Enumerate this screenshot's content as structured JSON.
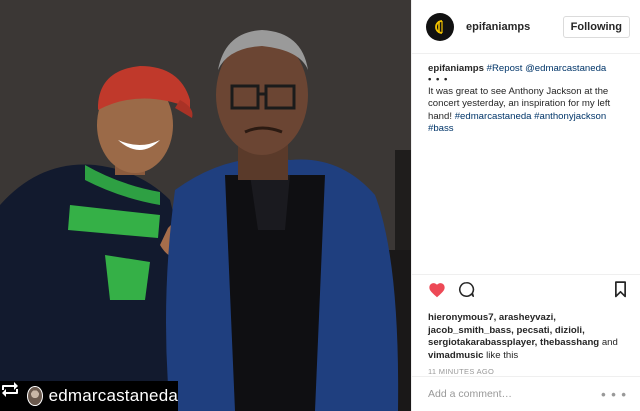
{
  "photo": {
    "repost_username": "edmarcastaneda",
    "repost_icon": "repost-icon"
  },
  "header": {
    "username": "epifaniamps",
    "follow_label": "Following",
    "avatar_icon": "brand-logo-icon"
  },
  "caption": {
    "username": "epifaniamps",
    "tag_repost": "#Repost",
    "mention": "@edmarcastaneda",
    "dots": "• • •",
    "text": "It was great to see Anthony Jackson at the concert yesterday, an inspiration for my left hand!",
    "hashtags": "#edmarcastaneda #anthonyjackson #bass"
  },
  "actions": {
    "like_icon": "heart-icon",
    "comment_icon": "comment-icon",
    "save_icon": "bookmark-icon",
    "like_color": "#ed4956"
  },
  "likes": {
    "names_bold": "hieronymous7, arasheyvazi, jacob_smith_bass, pecsati, dizioli, sergiotakarabassplayer, thebasshang",
    "and_word": " and ",
    "last_name": "vimadmusic",
    "suffix": " like this"
  },
  "timestamp": "11 MINUTES AGO",
  "comment": {
    "placeholder": "Add a comment…",
    "more_label": "• • •"
  }
}
